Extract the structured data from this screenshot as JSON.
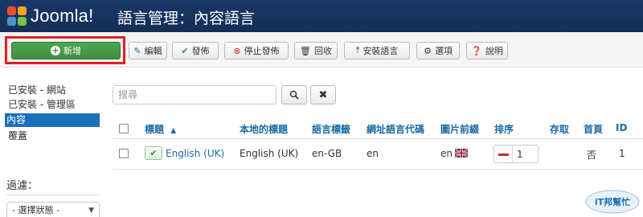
{
  "header": {
    "logo_text": "Joomla!",
    "title": "語言管理：內容語言",
    "background": "#1a3867"
  },
  "toolbar": {
    "new_label": "新增",
    "edit_label": "編輯",
    "publish_label": "發佈",
    "unpublish_label": "停止發佈",
    "trash_label": "回收",
    "install_label": "安裝語言",
    "options_label": "選項",
    "help_label": "說明",
    "highlight_color": "#e31e24",
    "new_color": "#3e8e41"
  },
  "sidebar": {
    "items": [
      {
        "label": "已安裝 - 網站",
        "active": false
      },
      {
        "label": "已安裝 - 管理區",
        "active": false
      },
      {
        "label": "內容",
        "active": true
      },
      {
        "label": "覆蓋",
        "active": false
      }
    ],
    "active_color": "#1b71b8",
    "filter_title": "過濾：",
    "filter_select_value": "- 選擇狀態 -"
  },
  "search": {
    "placeholder": "搜尋",
    "search_icon": "search-icon",
    "clear_icon": "clear-icon"
  },
  "table": {
    "headers": {
      "title": "標題",
      "sort_arrow": "▲",
      "native_title": "本地的標題",
      "lang_tag": "語言標籤",
      "url_code": "網址語言代碼",
      "image_prefix": "圖片前綴",
      "ordering": "排序",
      "access": "存取",
      "home": "首頁",
      "id": "ID"
    },
    "rows": [
      {
        "title": "English (UK)",
        "native_title": "English (UK)",
        "lang_tag": "en-GB",
        "url_code": "en",
        "image_prefix": "en",
        "ordering": "1",
        "access": "",
        "home": "否",
        "id": "1"
      }
    ],
    "link_color": "#1b6aa5"
  },
  "watermark": {
    "text": "iT邦幫忙"
  }
}
